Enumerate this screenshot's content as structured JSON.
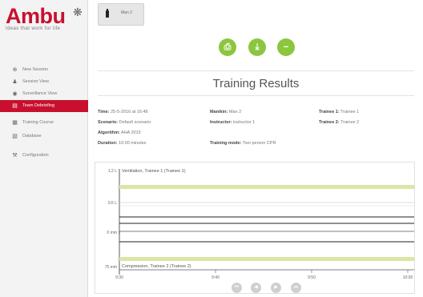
{
  "sidebar": {
    "logo": {
      "brand": "Ambu",
      "tagline": "Ideas that work for life"
    },
    "items": [
      {
        "label": "New Session",
        "icon": "plus-circle-icon",
        "glyph": "⊕",
        "active": false
      },
      {
        "label": "Session View",
        "icon": "user-icon",
        "glyph": "♟",
        "active": false
      },
      {
        "label": "Surveillance View",
        "icon": "eye-icon",
        "glyph": "◉",
        "active": false
      },
      {
        "label": "Team Debriefing",
        "icon": "document-icon",
        "glyph": "▤",
        "active": true
      },
      {
        "label": "Training Course",
        "icon": "course-icon",
        "glyph": "▦",
        "active": false
      },
      {
        "label": "Database",
        "icon": "database-icon",
        "glyph": "▧",
        "active": false
      },
      {
        "label": "Configuration",
        "icon": "settings-icon",
        "glyph": "⚒",
        "active": false
      }
    ]
  },
  "device_tab": {
    "label": "Man 2",
    "icon": "battery-icon"
  },
  "actions": {
    "print": {
      "icon": "printer-icon",
      "glyph": "⎙"
    },
    "export": {
      "icon": "download-icon",
      "glyph": "⤓"
    },
    "close": {
      "icon": "minus-icon",
      "glyph": "−"
    }
  },
  "title": "Training Results",
  "info": {
    "time_label": "Time:",
    "time": "25-5-2016 at 16:48",
    "manikin_label": "Manikin:",
    "manikin": "Man 2",
    "trainee1_label": "Trainee 1:",
    "trainee1": "Trainee 1",
    "scenario_label": "Scenario:",
    "scenario": "Default scenario",
    "instructor_label": "Instructor:",
    "instructor": "instructor 1",
    "trainee2_label": "Trainee 2:",
    "trainee2": "Trainee 2",
    "algorithm_label": "Algorithm:",
    "algorithm": "AHA 2015",
    "duration_label": "Duration:",
    "duration": "10:00 minutes",
    "mode_label": "Training mode:",
    "mode": "Two person CPR"
  },
  "chart_data": {
    "type": "line",
    "x_ticks": [
      "9:30",
      "9:40",
      "9:50",
      "10:00"
    ],
    "ventilation": {
      "title": "Ventilation, Trainee 1 (Trainee 1)",
      "y_ticks": [
        "1.2 L",
        "0.6 L"
      ],
      "band_color": "#d9e6a6"
    },
    "compression": {
      "title": "Compression, Trainee 2 (Trainee 2)",
      "y_ticks": [
        "0 mm",
        "75 mm"
      ],
      "band_color": "#d9e6a6"
    },
    "line_color": "#222222"
  },
  "player": [
    {
      "icon": "skip-back-icon",
      "glyph": "⏮"
    },
    {
      "icon": "step-back-icon",
      "glyph": "◀"
    },
    {
      "icon": "play-icon",
      "glyph": "▶"
    },
    {
      "icon": "skip-forward-icon",
      "glyph": "⏭"
    }
  ],
  "colors": {
    "accent": "#c8102e",
    "action": "#8cc63f",
    "band": "#d9e6a6"
  }
}
